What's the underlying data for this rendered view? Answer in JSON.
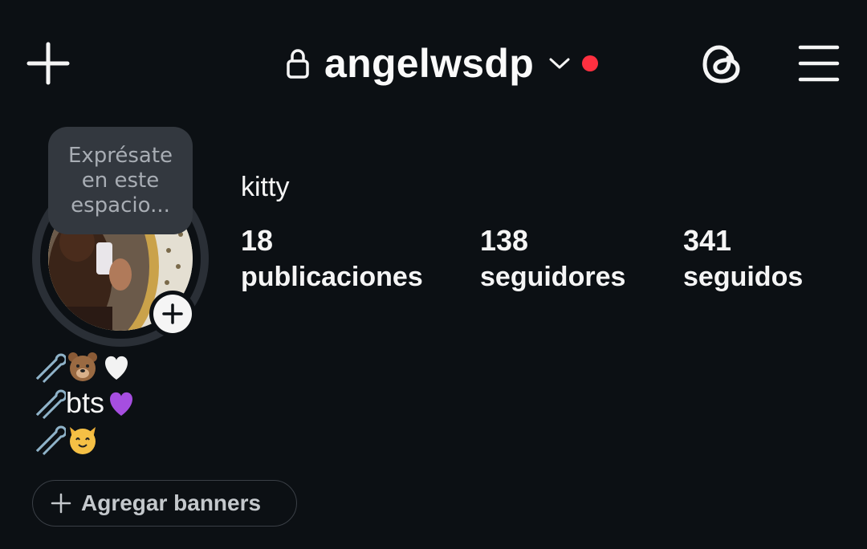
{
  "header": {
    "username": "angelwsdp",
    "icons": [
      "plus-icon",
      "lock-icon",
      "chevron-down-icon",
      "notification-dot",
      "threads-icon",
      "hamburger-menu-icon"
    ],
    "notification_color": "#ff3040"
  },
  "profile": {
    "note_placeholder": "Exprésate en este espacio...",
    "display_name": "kitty",
    "stats": [
      {
        "value": "18",
        "label": "publicaciones"
      },
      {
        "value": "138",
        "label": "seguidores"
      },
      {
        "value": "341",
        "label": "seguidos"
      }
    ],
    "bio": {
      "lines": [
        {
          "emojis": [
            "safety-pin",
            "bear-face",
            "white-heart"
          ],
          "text": ""
        },
        {
          "emojis": [
            "safety-pin"
          ],
          "text": "bts",
          "trailing_emojis": [
            "purple-heart"
          ]
        },
        {
          "emojis": [
            "safety-pin",
            "cat-face"
          ],
          "text": ""
        }
      ]
    }
  },
  "actions": {
    "add_banners_label": "Agregar banners"
  },
  "colors": {
    "background": "#0c1014",
    "text": "#f5f5f5",
    "muted": "#a8adb4",
    "note_bubble": "#33383f"
  }
}
